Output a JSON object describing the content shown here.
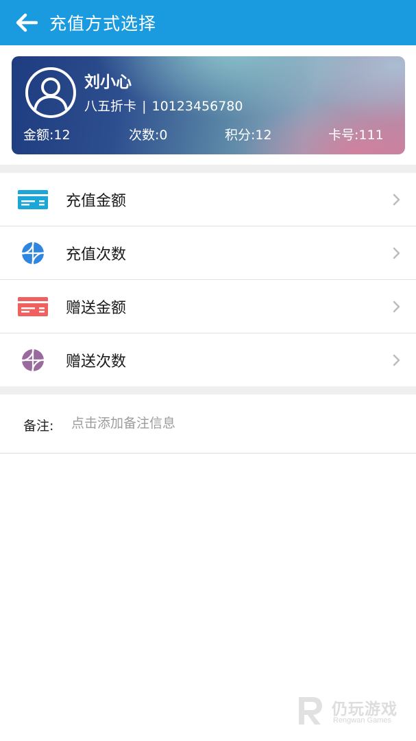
{
  "app_bar": {
    "title": "充值方式选择",
    "back_icon": "arrow-left-icon",
    "background": "#1a9be0"
  },
  "member_card": {
    "name": "刘小心",
    "card_type": "八五折卡",
    "separator": "|",
    "phone": "10123456780",
    "avatar_icon": "user-avatar-icon",
    "stats": [
      {
        "label": "金额:12"
      },
      {
        "label": "次数:0"
      },
      {
        "label": "积分:12"
      },
      {
        "label": "卡号:111"
      }
    ]
  },
  "menu": {
    "items": [
      {
        "label": "充值金额",
        "icon": "card-icon",
        "icon_color": "#1aa6d6"
      },
      {
        "label": "充值次数",
        "icon": "basketball-icon",
        "icon_color": "#2e86de"
      },
      {
        "label": "赠送金额",
        "icon": "card-icon",
        "icon_color": "#f0605f"
      },
      {
        "label": "赠送次数",
        "icon": "basketball-icon",
        "icon_color": "#9a6a9f"
      }
    ],
    "arrow_icon": "chevron-right-icon"
  },
  "remark": {
    "label": "备注:",
    "placeholder": "点击添加备注信息",
    "value": ""
  },
  "watermark": {
    "text": "仍玩游戏",
    "subtext": "Rengwan Games"
  }
}
